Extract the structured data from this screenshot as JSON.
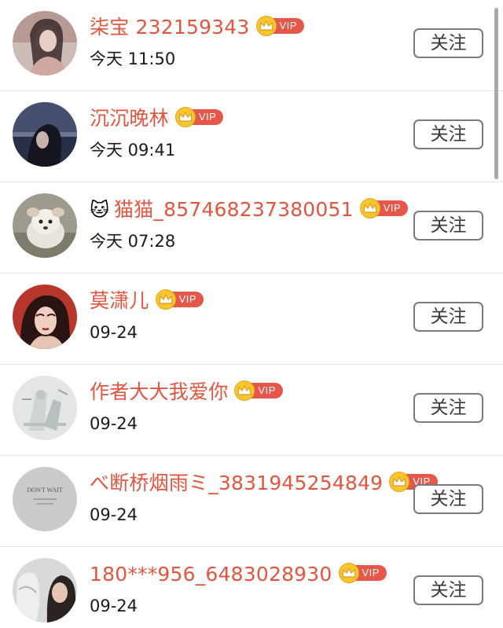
{
  "follow_label": "关注",
  "vip_label": "VIP",
  "colors": {
    "name": "#e4553f",
    "vip_badge": "#e6574a",
    "crown": "#f6c631",
    "divider": "#e3e3e3"
  },
  "users": [
    {
      "emoji": "",
      "name": "柒宝 232159343",
      "time": "今天 11:50",
      "vip": true
    },
    {
      "emoji": "",
      "name": "沉沉晚林",
      "time": "今天 09:41",
      "vip": true
    },
    {
      "emoji": "🐱",
      "name": "猫猫_857468237380051",
      "time": "今天 07:28",
      "vip": true
    },
    {
      "emoji": "",
      "name": "莫潇儿",
      "time": "09-24",
      "vip": true
    },
    {
      "emoji": "",
      "name": "作者大大我爱你",
      "time": "09-24",
      "vip": true
    },
    {
      "emoji": "",
      "name": "べ断桥烟雨ミ_3831945254849",
      "time": "09-24",
      "vip": true
    },
    {
      "emoji": "",
      "name": "180***956_6483028930",
      "time": "09-24",
      "vip": true
    }
  ],
  "avatars": [
    {
      "icon": "avatar-photo-girl-dark",
      "text": ""
    },
    {
      "icon": "avatar-photo-girl-night",
      "text": ""
    },
    {
      "icon": "avatar-photo-puppy",
      "text": ""
    },
    {
      "icon": "avatar-photo-girl-red",
      "text": ""
    },
    {
      "icon": "avatar-photo-sketch",
      "text": ""
    },
    {
      "icon": "avatar-photo-card",
      "text": "DON'T WAIT"
    },
    {
      "icon": "avatar-photo-statue",
      "text": ""
    }
  ]
}
